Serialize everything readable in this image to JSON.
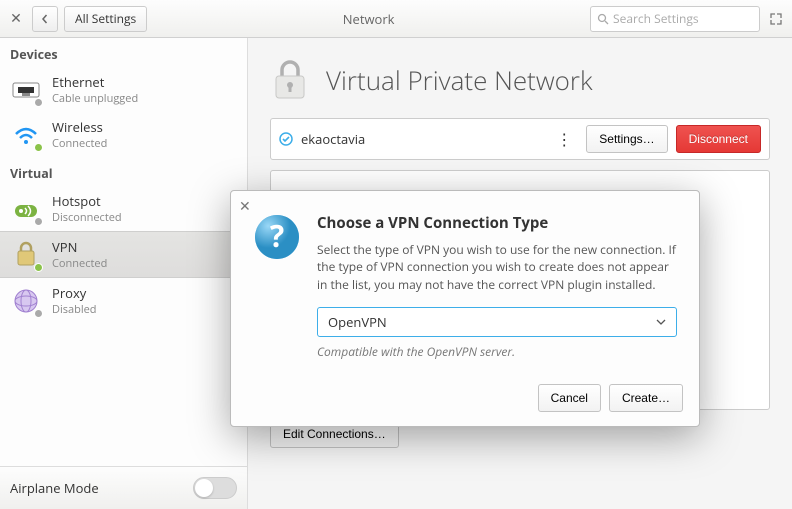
{
  "titlebar": {
    "all_settings": "All Settings",
    "title": "Network",
    "search_placeholder": "Search Settings"
  },
  "sidebar": {
    "section_devices": "Devices",
    "section_virtual": "Virtual",
    "items": [
      {
        "name": "Ethernet",
        "status": "Cable unplugged"
      },
      {
        "name": "Wireless",
        "status": "Connected"
      },
      {
        "name": "Hotspot",
        "status": "Disconnected"
      },
      {
        "name": "VPN",
        "status": "Connected"
      },
      {
        "name": "Proxy",
        "status": "Disabled"
      }
    ],
    "airplane": "Airplane Mode"
  },
  "main": {
    "title": "Virtual Private Network",
    "connection_name": "ekaoctavia",
    "settings_btn": "Settings…",
    "disconnect_btn": "Disconnect",
    "edit_connections_btn": "Edit Connections…"
  },
  "dialog": {
    "title": "Choose a VPN Connection Type",
    "text": "Select the type of VPN you wish to use for the new connection.  If the type of VPN connection you wish to create does not appear in the list, you may not have the correct VPN plugin installed.",
    "combo_value": "OpenVPN",
    "compat": "Compatible with the OpenVPN server.",
    "cancel": "Cancel",
    "create": "Create…"
  }
}
